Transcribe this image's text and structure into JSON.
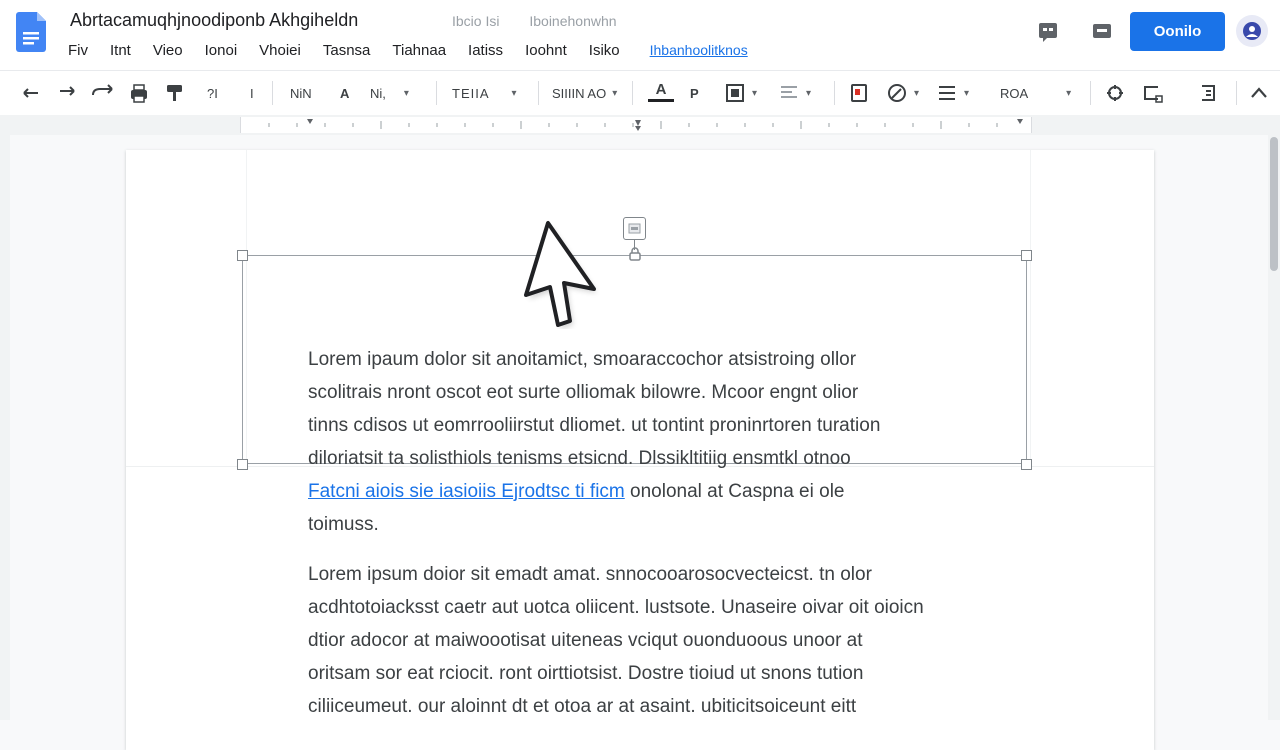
{
  "header": {
    "title": "Abrtacamuqhjnoodiponb Akhgiheldn",
    "meta": [
      "Ibcio Isi",
      "Iboinehonwhn"
    ],
    "menu": [
      "Fiv",
      "Itnt",
      "Vieo",
      "Ionoi",
      "Vhoiei",
      "Tasnsa",
      "Tiahnaa",
      "Iatiss",
      "Ioohnt",
      "Isiko"
    ],
    "last_edit": "Ihbanhoolitknos",
    "share_label": "Oonilo",
    "icons": [
      "google-docs-logo",
      "history-icon",
      "comment-icon",
      "avatar"
    ]
  },
  "toolbar": {
    "items": [
      {
        "name": "undo",
        "label": ""
      },
      {
        "name": "redo",
        "label": ""
      },
      {
        "name": "redo-alt",
        "label": ""
      },
      {
        "name": "print",
        "label": ""
      },
      {
        "name": "paint-format",
        "label": ""
      },
      {
        "name": "spellcheck",
        "label": "?I"
      },
      {
        "name": "clear",
        "label": "I"
      },
      {
        "name": "zoom",
        "label": "NiN"
      },
      {
        "name": "text-color-a",
        "label": "A"
      },
      {
        "name": "style",
        "label": "Ni,"
      },
      {
        "name": "font",
        "label": "TEIIA"
      },
      {
        "name": "font-size",
        "label": "SIIIIN AO"
      },
      {
        "name": "text-color",
        "label": "A"
      },
      {
        "name": "highlight",
        "label": "P"
      },
      {
        "name": "insert-link",
        "label": ""
      },
      {
        "name": "align",
        "label": ""
      },
      {
        "name": "image",
        "label": ""
      },
      {
        "name": "edit-mode",
        "label": ""
      },
      {
        "name": "list",
        "label": ""
      },
      {
        "name": "more-options",
        "label": "ROA"
      },
      {
        "name": "move",
        "label": ""
      },
      {
        "name": "crop",
        "label": ""
      },
      {
        "name": "replace",
        "label": ""
      },
      {
        "name": "collapse",
        "label": ""
      }
    ]
  },
  "document": {
    "paragraph1": [
      "Lorem ipaum dolor sit anoitamict, smoaraccochor atsistroing ollor",
      "scolitrais nront oscot eot surte olliomak bilowre. Mcoor engnt olior",
      "tinns cdisos ut eomrrooliirstut dliomet. ut tontint proninrtoren turation",
      "diloriatsit ta solisthiols tenisms etsicnd. Dlssikltitiig ensmtkl otnoo"
    ],
    "link_text": "Fatcni aiois sie iasioiis Ejrodtsc ti ficm",
    "link_rest": " onolonal at Caspna ei ole",
    "paragraph1_end": "toimuss.",
    "paragraph2": [
      "Lorem ipsum doior sit emadt amat. snnocooarosocvecteicst. tn olor",
      "acdhtotoiacksst caetr aut uotca oliicent. lustsote. Unaseire oivar oit oioicn",
      "dtior adocor at maiwoootisat uiteneas vciqut ouonduoous unoor at",
      "oritsam sor eat rciocit. ront oirttiotsist. Dostre tioiud ut snons tution",
      "ciliiceumeut. our aloinnt dt et otoa ar at asaint. ubiticitsoiceunt eitt"
    ]
  },
  "colors": {
    "accent": "#1a73e8",
    "text": "#3c4043",
    "selection": "#9aa0a6",
    "canvas": "#f8f9fa"
  }
}
